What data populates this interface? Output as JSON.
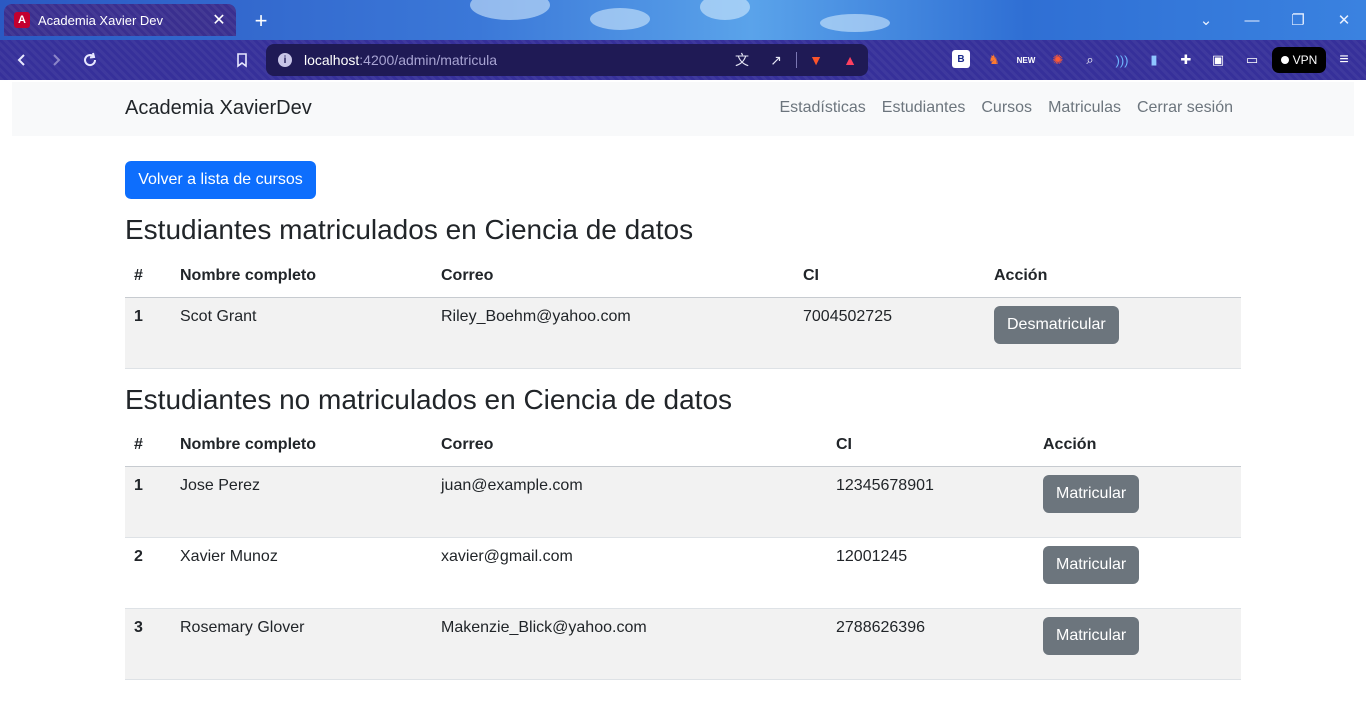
{
  "browser": {
    "tab_title": "Academia Xavier Dev",
    "tab_favicon_text": "A",
    "url_host": "localhost",
    "url_path": ":4200/admin/matricula",
    "extensions": [
      "B",
      "NEW"
    ],
    "vpn_label": "VPN"
  },
  "navbar": {
    "brand": "Academia XavierDev",
    "links": [
      "Estadísticas",
      "Estudiantes",
      "Cursos",
      "Matriculas",
      "Cerrar sesión"
    ]
  },
  "back_button": "Volver a lista de cursos",
  "enrolled": {
    "title": "Estudiantes matriculados en Ciencia de datos",
    "columns": [
      "#",
      "Nombre completo",
      "Correo",
      "CI",
      "Acción"
    ],
    "rows": [
      {
        "num": "1",
        "name": "Scot Grant",
        "email": "Riley_Boehm@yahoo.com",
        "ci": "7004502725",
        "action": "Desmatricular"
      }
    ]
  },
  "not_enrolled": {
    "title": "Estudiantes no matriculados en Ciencia de datos",
    "columns": [
      "#",
      "Nombre completo",
      "Correo",
      "CI",
      "Acción"
    ],
    "rows": [
      {
        "num": "1",
        "name": "Jose Perez",
        "email": "juan@example.com",
        "ci": "12345678901",
        "action": "Matricular"
      },
      {
        "num": "2",
        "name": "Xavier Munoz",
        "email": "xavier@gmail.com",
        "ci": "12001245",
        "action": "Matricular"
      },
      {
        "num": "3",
        "name": "Rosemary Glover",
        "email": "Makenzie_Blick@yahoo.com",
        "ci": "2788626396",
        "action": "Matricular"
      }
    ]
  },
  "colors": {
    "primary": "#0d6efd",
    "secondary": "#6c757d",
    "navbar_bg": "#f8f9fa",
    "stripe": "#f2f2f2"
  }
}
